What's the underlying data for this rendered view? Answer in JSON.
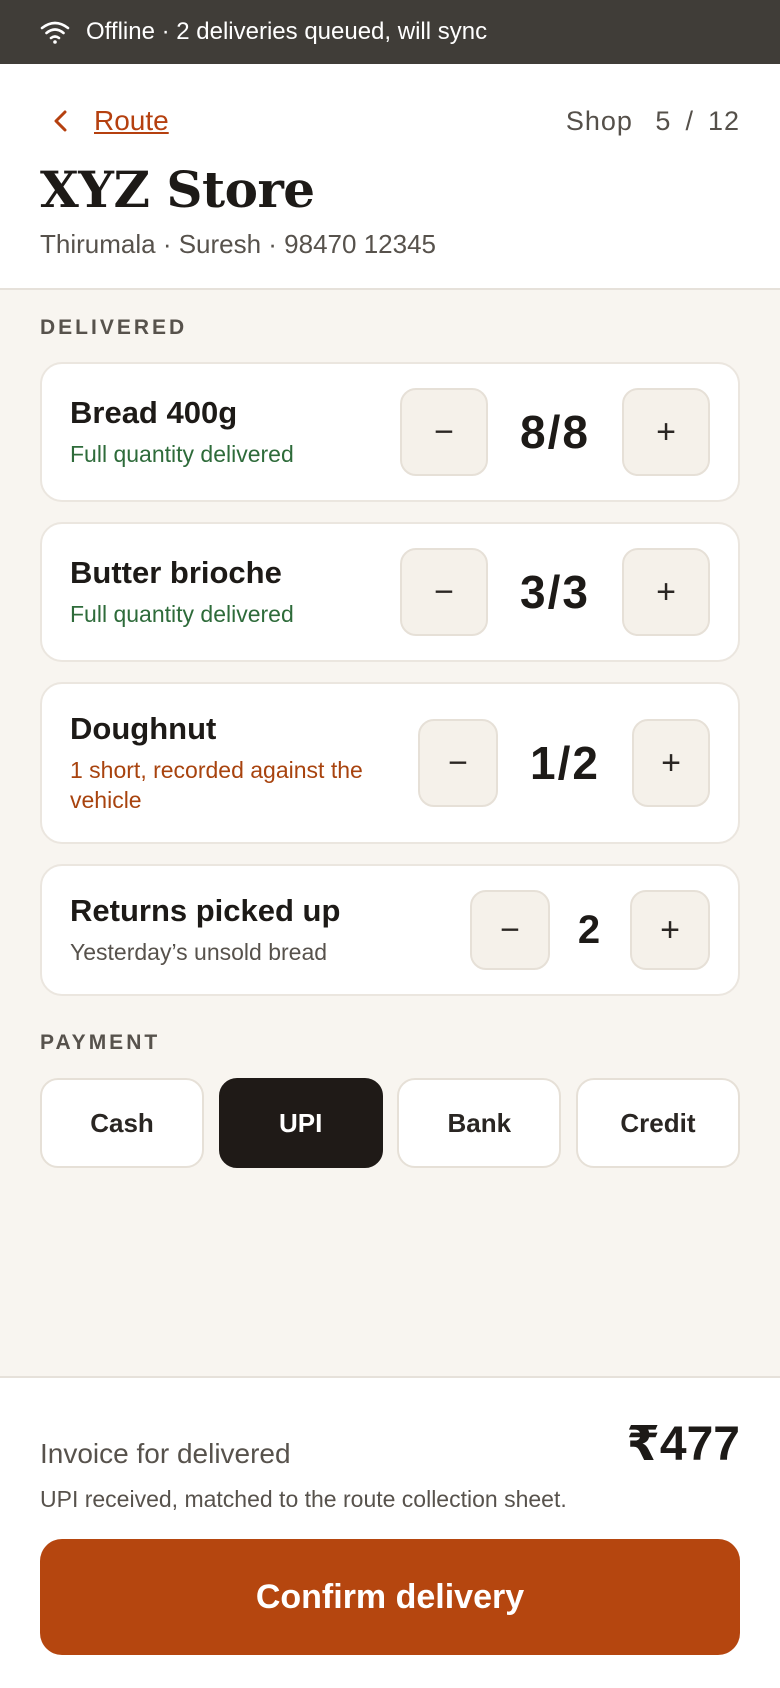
{
  "status_bar": {
    "icon": "wifi-icon",
    "text": "Offline · 2 deliveries queued, will sync"
  },
  "header": {
    "back_label": "Route",
    "back_icon": "chevron-left-icon",
    "shop_label": "Shop",
    "shop_current": "5",
    "shop_separator": "/",
    "shop_total": "12",
    "store_name": "XYZ Store",
    "store_meta": "Thirumala · Suresh · 98470 12345"
  },
  "delivered": {
    "section_label": "DELIVERED",
    "items": [
      {
        "name": "Bread 400g",
        "status": "Full quantity delivered",
        "qty": "8/8"
      },
      {
        "name": "Butter brioche",
        "status": "Full quantity delivered",
        "qty": "3/3"
      },
      {
        "name": "Doughnut",
        "status": "1 short, recorded against the vehicle",
        "qty": "1/2"
      }
    ],
    "returns": {
      "name": "Returns picked up",
      "note": "Yesterday’s unsold bread",
      "qty": "2"
    },
    "minus_label": "−",
    "plus_label": "+"
  },
  "payment": {
    "section_label": "PAYMENT",
    "options": [
      "Cash",
      "UPI",
      "Bank",
      "Credit"
    ],
    "selected": "UPI"
  },
  "footer": {
    "total_label": "Invoice for delivered",
    "total_amount": "₹477",
    "note": "UPI received, matched to the route collection sheet.",
    "confirm_label": "Confirm delivery"
  },
  "colors": {
    "accent": "#b5460f",
    "ok": "#2e6b3a",
    "warn": "#a8430e",
    "status_bar": "#403d38",
    "selected_payment": "#1f1a17"
  }
}
